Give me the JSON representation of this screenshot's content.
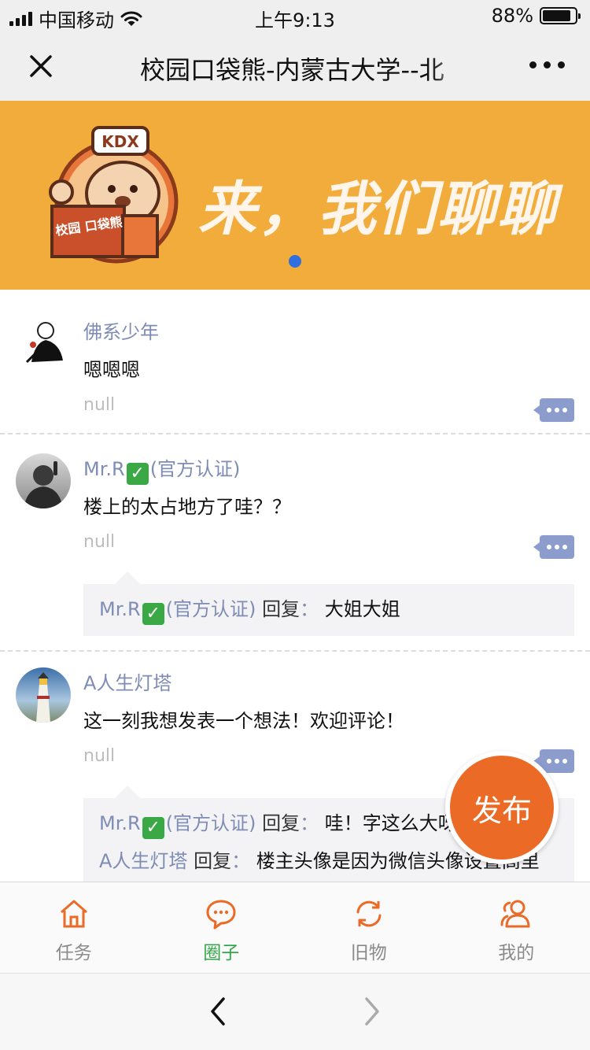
{
  "status_bar": {
    "carrier": "中国移动",
    "time": "上午9:13",
    "battery_percent": "88%",
    "battery_level": 0.88,
    "icons": [
      "signal-icon",
      "wifi-icon",
      "battery-icon"
    ]
  },
  "nav": {
    "title": "校园口袋熊-内蒙古大学--北",
    "close_icon": "close-icon",
    "more_icon": "more-dots-icon"
  },
  "banner": {
    "logo_badge": "KDX",
    "logo_text": "校园 口袋熊",
    "headline": "来，我们聊聊",
    "background": "#f1ac3b",
    "active_dot_color": "#2f6fde"
  },
  "posts": [
    {
      "author": "佛系少年",
      "verified": false,
      "content": "嗯嗯嗯",
      "meta": "null",
      "replies": []
    },
    {
      "author": "Mr.R",
      "verified": true,
      "verified_label": "(官方认证)",
      "content": "楼上的太占地方了哇？？",
      "meta": "null",
      "replies": [
        {
          "name": "Mr.R",
          "verified": true,
          "verified_label": "(官方认证)",
          "label": "回复",
          "colon": "：",
          "text": "大姐大姐"
        }
      ]
    },
    {
      "author": "A人生灯塔",
      "verified": false,
      "content": "这一刻我想发表一个想法！欢迎评论！",
      "meta": "null",
      "replies": [
        {
          "name": "Mr.R",
          "verified": true,
          "verified_label": "(官方认证)",
          "label": "回复",
          "colon": "：",
          "text": "哇！字这么大呀"
        },
        {
          "name": "A人生灯塔",
          "verified": false,
          "label": "回复",
          "colon": "：",
          "text": "楼主头像是因为微信头像设置高里"
        }
      ]
    }
  ],
  "fab": {
    "label": "发布",
    "color": "#eb6a26"
  },
  "tabs": [
    {
      "label": "任务",
      "icon": "home-icon",
      "active": false
    },
    {
      "label": "圈子",
      "icon": "chat-bubble-icon",
      "active": true
    },
    {
      "label": "旧物",
      "icon": "refresh-icon",
      "active": false
    },
    {
      "label": "我的",
      "icon": "users-icon",
      "active": false
    }
  ],
  "colors": {
    "accent_orange": "#eb6a26",
    "active_tab_green": "#33a849",
    "author_blue": "#7f8db5"
  },
  "browser": {
    "back_icon": "chevron-left-icon",
    "forward_icon": "chevron-right-icon"
  }
}
